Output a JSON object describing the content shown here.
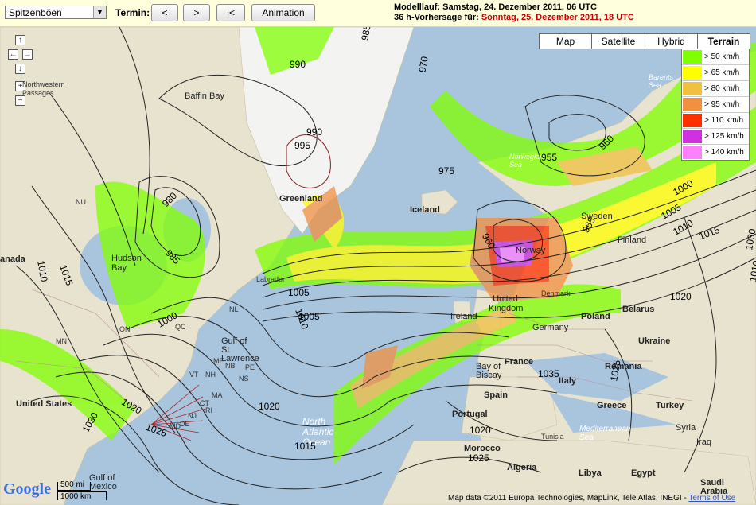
{
  "toolbar": {
    "select_value": "Spitzenböen",
    "termin_label": "Termin:",
    "prev_label": "<",
    "next_label": ">",
    "first_label": "|<",
    "animation_label": "Animation",
    "model_run": "Modelllauf: Samstag, 24. Dezember 2011, 06 UTC",
    "forecast_prefix": "36 h-Vorhersage für:",
    "forecast_time": "Sonntag, 25. Dezember 2011, 18 UTC"
  },
  "map_types": [
    {
      "label": "Map",
      "active": false
    },
    {
      "label": "Satellite",
      "active": false
    },
    {
      "label": "Hybrid",
      "active": false
    },
    {
      "label": "Terrain",
      "active": true
    }
  ],
  "legend": [
    {
      "label": "> 50 km/h",
      "color": "#80ff00"
    },
    {
      "label": "> 65 km/h",
      "color": "#ffff00"
    },
    {
      "label": "> 80 km/h",
      "color": "#f0c040"
    },
    {
      "label": "> 95 km/h",
      "color": "#f09040"
    },
    {
      "label": "> 110 km/h",
      "color": "#ff3000"
    },
    {
      "label": "> 125 km/h",
      "color": "#d030e0"
    },
    {
      "label": "> 140 km/h",
      "color": "#ff80ff"
    }
  ],
  "nav": {
    "up": "↑",
    "left": "←",
    "right": "→",
    "down": "↓",
    "zoom_in": "+",
    "zoom_out": "−"
  },
  "places": {
    "greenland": "Greenland",
    "iceland": "Iceland",
    "norway": "Norway",
    "sweden": "Sweden",
    "finland": "Finland",
    "united_kingdom": "United Kingdom",
    "ireland": "Ireland",
    "denmark": "Denmark",
    "germany": "Germany",
    "poland": "Poland",
    "belarus": "Belarus",
    "ukraine": "Ukraine",
    "france": "France",
    "spain": "Spain",
    "portugal": "Portugal",
    "italy": "Italy",
    "romania": "Romania",
    "greece": "Greece",
    "turkey": "Turkey",
    "syria": "Syria",
    "iraq": "Iraq",
    "morocco": "Morocco",
    "algeria": "Algeria",
    "tunisia": "Tunisia",
    "libya": "Libya",
    "egypt": "Egypt",
    "saudi_arabia": "Saudi Arabia",
    "united_states": "United States",
    "canada": "anada",
    "hudson_bay": "Hudson Bay",
    "baffin_bay": "Baffin Bay",
    "labrador": "Labrador",
    "northwestern_passages": "Northwestern Passages",
    "bay_of_biscay": "Bay of Biscay",
    "gulf_st_lawrence": "Gulf of St Lawrence",
    "north_atlantic": "North Atlantic Ocean",
    "gulf_of_mexico": "Gulf of Mexico",
    "med_sea": "Mediterranean Sea",
    "barents_sea": "Barents Sea",
    "norwegian_sea": "Norwegian Sea"
  },
  "isobars": [
    "985",
    "990",
    "970",
    "955",
    "960",
    "990",
    "995",
    "980",
    "975",
    "985",
    "960",
    "965",
    "1000",
    "1005",
    "1010",
    "1015",
    "1020",
    "1025",
    "1030",
    "1035",
    "1005",
    "1010",
    "1010",
    "1015",
    "1020",
    "1025",
    "1030",
    "1000",
    "1005",
    "1020",
    "1025",
    "1015",
    "1020",
    "1010"
  ],
  "states": [
    "NU",
    "NL",
    "QC",
    "ON",
    "MN",
    "ME",
    "VT",
    "NH",
    "MA",
    "CT",
    "RI",
    "NJ",
    "DE",
    "MD",
    "PE",
    "NS",
    "NB"
  ],
  "scale": {
    "miles": "500 mi",
    "km": "1000 km"
  },
  "copyright": {
    "text": "Map data ©2011 Europa Technologies, MapLink, Tele Atlas, INEGI - ",
    "link": "Terms of Use"
  },
  "google_logo": "Google"
}
